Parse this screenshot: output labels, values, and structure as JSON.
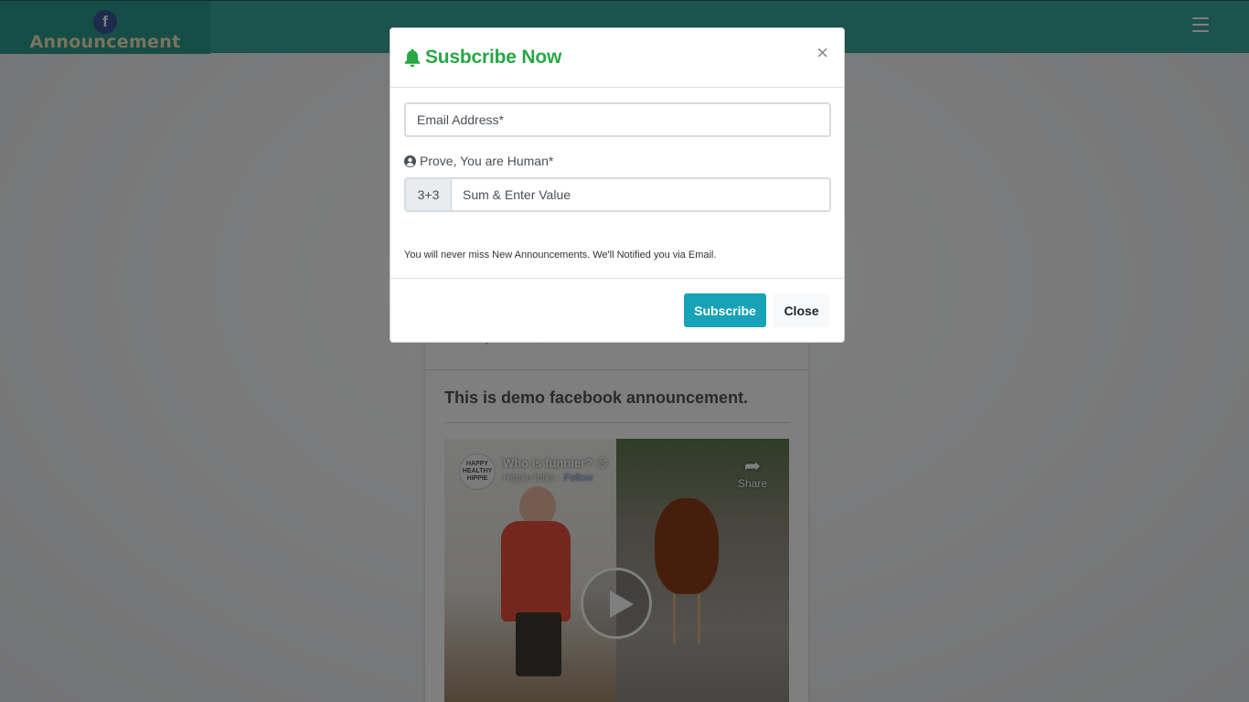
{
  "header": {
    "brand_icon_letter": "f",
    "brand_text": "Announcement"
  },
  "card": {
    "date": "27 September, 2020",
    "title": "This is demo facebook announcement.",
    "video": {
      "avatar_text": "HAPPY HEALTHY HIPPIE",
      "title": "Who is funnier? 😄",
      "channel": "Hippie folks",
      "separator": "·",
      "follow": "Follow",
      "share": "Share"
    }
  },
  "modal": {
    "title": "Susbcribe Now",
    "close_symbol": "×",
    "email_placeholder": "Email Address*",
    "human_label": "Prove, You are Human*",
    "captcha_question": "3+3",
    "captcha_placeholder": "Sum & Enter Value",
    "note": "You will never miss New Announcements. We'll Notified you via Email.",
    "subscribe_label": "Subscribe",
    "close_label": "Close"
  },
  "colors": {
    "topbar": "#3aa79b",
    "title_green": "#28a745",
    "subscribe_button": "#17a2b8"
  }
}
